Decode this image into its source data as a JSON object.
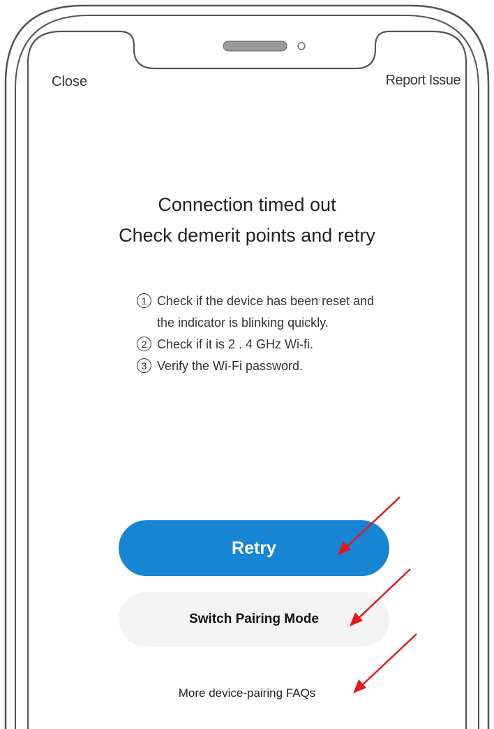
{
  "nav": {
    "close_label": "Close",
    "report_label": "Report Issue"
  },
  "headline": {
    "line1": "Connection timed out",
    "line2": "Check demerit points and retry"
  },
  "steps": [
    {
      "number": "1",
      "line1": "Check if the device has been reset and",
      "line2": "the indicator is blinking quickly."
    },
    {
      "number": "2",
      "line1": "Check if it is 2 . 4 GHz Wi-fi.",
      "line2": ""
    },
    {
      "number": "3",
      "line1": "Verify the Wi-Fi password.",
      "line2": ""
    }
  ],
  "actions": {
    "retry_label": "Retry",
    "switch_label": "Switch Pairing Mode",
    "faq_label": "More device-pairing FAQs"
  },
  "colors": {
    "primary": "#1784d4",
    "secondary_button": "#f3f3f3",
    "annotation_arrow": "#e5171b",
    "frame": "#555555"
  },
  "icons": {
    "speaker": "speaker-grille-icon",
    "camera": "front-camera-icon",
    "arrows": "red-pointer-arrow-icon"
  }
}
